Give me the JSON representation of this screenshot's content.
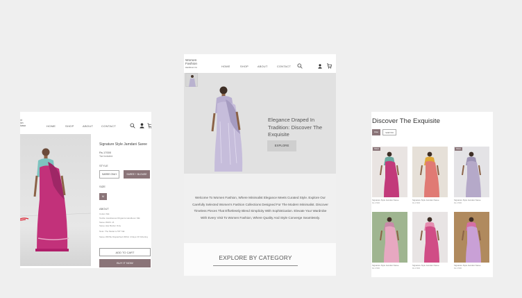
{
  "product_page": {
    "logo": [
      "nt",
      "ion",
      "icasa"
    ],
    "nav": [
      "HOME",
      "SHOP",
      "ABOUT",
      "CONTACT"
    ],
    "icons": [
      "search-icon",
      "user-icon",
      "cart-icon"
    ],
    "title": "Signature Style Jamdani Saree",
    "price": "Rs.17000",
    "tax_note": "Tax Included.",
    "style_label": "STYLE",
    "style_options": [
      {
        "label": "SAREE ONLY",
        "selected": false
      },
      {
        "label": "SAREE + BLOUSE",
        "selected": true
      }
    ],
    "size_label": "SIZE",
    "size_value": "M",
    "about_label": "ABOUT",
    "about_lines": [
      "Cotton Silk",
      "Textile: Handwoven/Organza Handloom Silk",
      "Saree Width: x6",
      "Saree Has Border Only",
      "",
      "Note: The Model is 5'8\" Tall.",
      "",
      "Saree Will Be Dispatched Within 4 Days Of Ordering"
    ],
    "add_to_cart": "ADD TO CART",
    "buy_now": "BUY IT NOW"
  },
  "home_page": {
    "logo_line1": "Women",
    "logo_line2": "Fashion",
    "logo_tagline": "Handloom Co",
    "nav": [
      "HOME",
      "SHOP",
      "ABOUT",
      "CONTACT"
    ],
    "icons": [
      "search-icon",
      "user-icon",
      "cart-icon"
    ],
    "headline": "Elegance Draped In Tradition: Discover The Exquisite",
    "explore_button": "EXPLORE",
    "intro": "Welcome To Women Fashion, Where Minimalist Elegance Meets Curated Style. Explore Our Carefully Selected Women's Fashion Collections Designed For The Modern Minimalist. Discover Timeless Pieces That Effortlessly Blend Simplicity With Sophistication. Elevate Your Wardrobe With Every Visit To Women Fashion, Where Quality And Style Converge Seamlessly.",
    "category_heading": "EXPLORE BY CATEGORY"
  },
  "collection_page": {
    "title": "Discover The  Exquisite",
    "filters": [
      "Filter",
      "SORT BY"
    ],
    "products": [
      {
        "tag": "SALE",
        "caption": "Signature Style Jamdani Saree",
        "price": "Rs.17000",
        "bg": "#e9e4e2",
        "saree": "#c23a7a",
        "blouse": "#6aa9a0"
      },
      {
        "tag": "",
        "caption": "Signature Style Jamdani Saree",
        "price": "Rs.17000",
        "bg": "#e6e0d8",
        "saree": "#e07a74",
        "blouse": "#e0a838"
      },
      {
        "tag": "SALE",
        "caption": "Signature Style Jamdani Saree",
        "price": "Rs.17000",
        "bg": "#e4e3e6",
        "saree": "#b5a9c9",
        "blouse": "#9c92b4"
      },
      {
        "tag": "",
        "caption": "Signature Style Jamdani Saree",
        "price": "Rs.17000",
        "bg": "#9fb590",
        "saree": "#e7a8c1",
        "blouse": "#c98aa9"
      },
      {
        "tag": "",
        "caption": "Signature Style Jamdani Saree",
        "price": "Rs.17000",
        "bg": "#e8e4e4",
        "saree": "#d04d86",
        "blouse": "#e58db0"
      },
      {
        "tag": "",
        "caption": "Signature Style Jamdani Saree",
        "price": "Rs.17000",
        "bg": "#b08a5e",
        "saree": "#c9a0d6",
        "blouse": "#d56ea5"
      }
    ]
  },
  "colors": {
    "accent": "#8a7478",
    "background": "#efefef"
  }
}
